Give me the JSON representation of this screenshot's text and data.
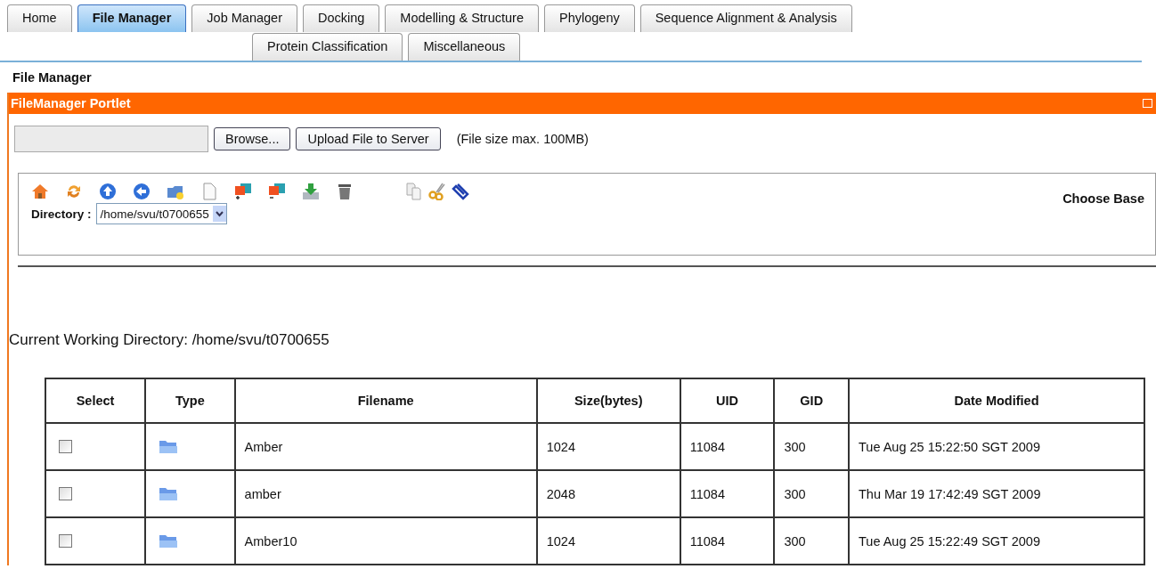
{
  "tab_rows": [
    [
      {
        "label": "Home",
        "selected": false
      },
      {
        "label": "File Manager",
        "selected": true
      },
      {
        "label": "Job Manager",
        "selected": false
      },
      {
        "label": "Docking",
        "selected": false
      },
      {
        "label": "Modelling & Structure",
        "selected": false
      },
      {
        "label": "Phylogeny",
        "selected": false
      },
      {
        "label": "Sequence Alignment & Analysis",
        "selected": false
      }
    ],
    [
      {
        "label": "Protein Classification",
        "selected": false
      },
      {
        "label": "Miscellaneous",
        "selected": false
      }
    ]
  ],
  "page_title": "File Manager",
  "portlet": {
    "title": "FileManager Portlet",
    "upload": {
      "browse_button": "Browse...",
      "upload_button": "Upload File to Server",
      "note": "(File size max. 100MB)"
    },
    "toolbar": {
      "directory_label": "Directory :",
      "directory_value": "/home/svu/t0700655",
      "choose_base_label": "Choose Base"
    },
    "cwd": "Current Working Directory: /home/svu/t0700655",
    "table": {
      "columns": [
        "Select",
        "Type",
        "Filename",
        "Size(bytes)",
        "UID",
        "GID",
        "Date Modified"
      ],
      "rows": [
        {
          "checked": false,
          "filename": "Amber",
          "size": "1024",
          "uid": "11084",
          "gid": "300",
          "modified": "Tue Aug 25 15:22:50 SGT 2009"
        },
        {
          "checked": false,
          "filename": "amber",
          "size": "2048",
          "uid": "11084",
          "gid": "300",
          "modified": "Thu Mar 19 17:42:49 SGT 2009"
        },
        {
          "checked": false,
          "filename": "Amber10",
          "size": "1024",
          "uid": "11084",
          "gid": "300",
          "modified": "Tue Aug 25 15:22:49 SGT 2009"
        }
      ]
    }
  }
}
